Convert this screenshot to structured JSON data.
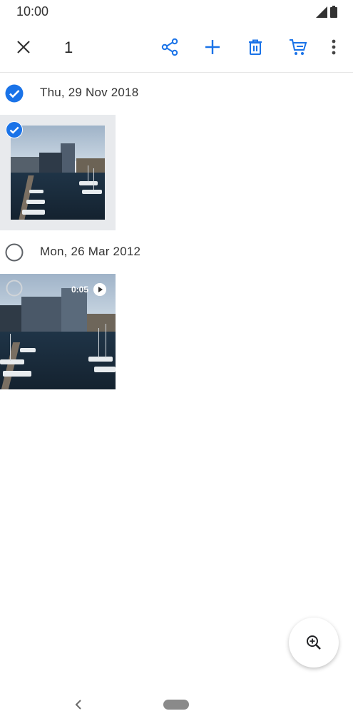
{
  "status_bar": {
    "time": "10:00"
  },
  "action_bar": {
    "selected_count": "1",
    "icons": [
      "close-icon",
      "share-icon",
      "add-icon",
      "delete-icon",
      "cart-icon",
      "more-vert-icon"
    ],
    "accent_color": "#1a73e8"
  },
  "groups": [
    {
      "date": "Thu, 29 Nov 2018",
      "selected": true
    },
    {
      "date": "Mon, 26 Mar 2012",
      "selected": false,
      "video_duration": "0:05"
    }
  ],
  "fab": {
    "icon": "zoom-in-icon"
  },
  "nav": {
    "icons": [
      "back-icon",
      "home-pill"
    ]
  }
}
